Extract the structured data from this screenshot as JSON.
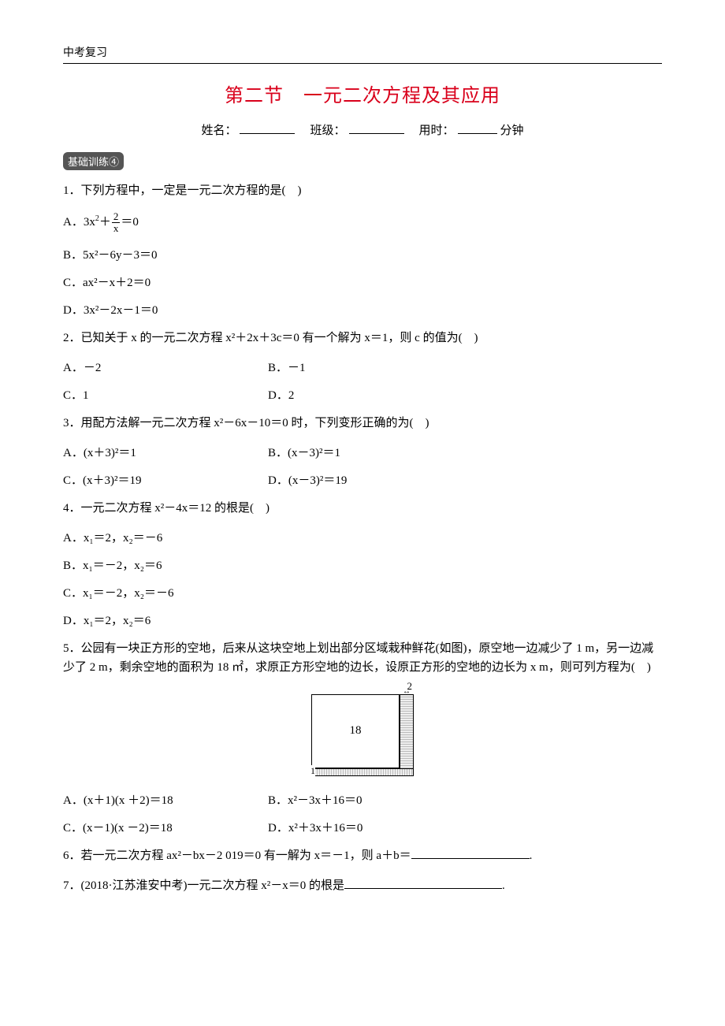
{
  "header_tag": "中考复习",
  "title": "第二节　一元二次方程及其应用",
  "info": {
    "name_label": "姓名：",
    "class_label": "班级：",
    "time_label": "用时：",
    "time_unit": "分钟"
  },
  "badge": "基础训练④",
  "q1": {
    "stem": "1．下列方程中，一定是一元二次方程的是(　)",
    "optA_pre": "A．3x",
    "optA_mid": "＋",
    "optA_frac_num": "2",
    "optA_frac_den": "x",
    "optA_post": "＝0",
    "optB": "B．5x²－6y－3＝0",
    "optC": "C．ax²－x＋2＝0",
    "optD": "D．3x²－2x－1＝0"
  },
  "q2": {
    "stem": "2．已知关于 x 的一元二次方程 x²＋2x＋3c＝0 有一个解为 x＝1，则 c 的值为(　)",
    "optA": "A．－2",
    "optB": "B．－1",
    "optC": "C．1",
    "optD": "D．2"
  },
  "q3": {
    "stem": "3．用配方法解一元二次方程 x²－6x－10＝0 时，下列变形正确的为(　)",
    "optA": "A．(x＋3)²＝1",
    "optB": "B．(x－3)²＝1",
    "optC": "C．(x＋3)²＝19",
    "optD": "D．(x－3)²＝19"
  },
  "q4": {
    "stem": "4．一元二次方程 x²－4x＝12 的根是(　)",
    "optA": "A．x₁＝2，x₂＝－6",
    "optB": "B．x₁＝－2，x₂＝6",
    "optC": "C．x₁＝－2，x₂＝－6",
    "optD": "D．x₁＝2，x₂＝6"
  },
  "q5": {
    "stem": "5．公园有一块正方形的空地，后来从这块空地上划出部分区域栽种鲜花(如图)，原空地一边减少了 1 m，另一边减少了 2 m，剩余空地的面积为 18 ㎡，求原正方形空地的边长，设原正方形的空地的边长为 x m，则可列方程为(　)",
    "fig_top": "2",
    "fig_center": "18",
    "fig_left": "1",
    "optA": "A．(x＋1)(x ＋2)＝18",
    "optB": "B．x²－3x＋16＝0",
    "optC": "C．(x－1)(x －2)＝18",
    "optD": "D．x²＋3x＋16＝0"
  },
  "q6": {
    "stem_pre": "6．若一元二次方程 ax²－bx－2 019＝0 有一解为 x＝－1，则 a＋b＝",
    "stem_post": "."
  },
  "q7": {
    "stem_pre": "7．(2018·江苏淮安中考)一元二次方程 x²－x＝0 的根是",
    "stem_post": "."
  }
}
